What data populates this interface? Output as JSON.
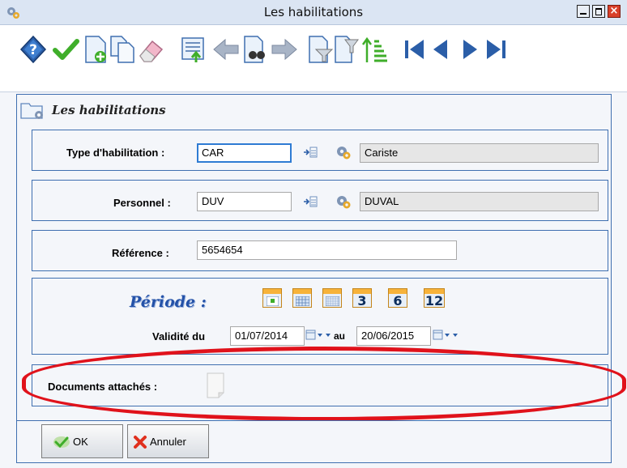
{
  "window": {
    "title": "Les habilitations",
    "close_glyph": "×"
  },
  "toolbar": {
    "icons": [
      "help-icon",
      "validate-check-icon",
      "new-record-icon",
      "copy-record-icon",
      "erase-icon",
      "export-list-icon",
      "back-arrow-icon",
      "search-binoculars-icon",
      "forward-arrow-icon",
      "filter-icon",
      "sort-filter-icon",
      "sort-icon",
      "first-record-icon",
      "previous-record-icon",
      "next-record-icon",
      "last-record-icon"
    ]
  },
  "section": {
    "title": "Les habilitations"
  },
  "form": {
    "type_label": "Type d'habilitation :",
    "type_code": "CAR",
    "type_name": "Cariste",
    "personnel_label": "Personnel :",
    "personnel_code": "DUV",
    "personnel_name": "DUVAL",
    "reference_label": "Référence :",
    "reference_value": "5654654"
  },
  "periode": {
    "title": "Période :",
    "presets": [
      "",
      "",
      "",
      "3",
      "6",
      "12"
    ],
    "validite_label": "Validité du",
    "date_from": "01/07/2014",
    "au_label": "au",
    "date_to": "20/06/2015"
  },
  "documents": {
    "label": "Documents attachés :"
  },
  "buttons": {
    "ok": "OK",
    "cancel": "Annuler"
  },
  "colors": {
    "accent_border": "#3f6fb0",
    "highlight": "#e0121b",
    "calendar_orange": "#f7b33a"
  }
}
